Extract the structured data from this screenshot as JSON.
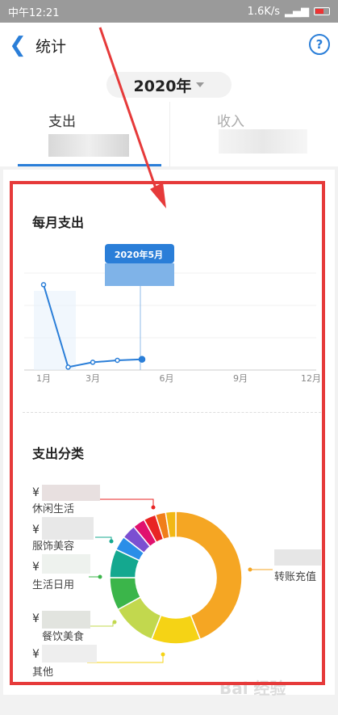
{
  "status": {
    "time": "中午12:21",
    "speed": "1.6K/s"
  },
  "header": {
    "title": "统计",
    "help_label": "?"
  },
  "year_selector": {
    "value": "2020年"
  },
  "tabs": [
    {
      "label": "支出"
    },
    {
      "label": "收入"
    }
  ],
  "monthly": {
    "section_title": "每月支出",
    "tooltip_title": "2020年5月",
    "x_ticks": [
      "1月",
      "3月",
      "6月",
      "9月",
      "12月"
    ]
  },
  "chart_data": [
    {
      "type": "line",
      "title": "每月支出",
      "x": [
        1,
        2,
        3,
        4,
        5
      ],
      "x_tick_labels": [
        "1月",
        "3月",
        "6月",
        "9月",
        "12月"
      ],
      "series": [
        {
          "values": [
            88,
            3,
            8,
            10,
            11
          ]
        }
      ],
      "ylim": [
        0,
        100
      ],
      "highlight": "2020年5月",
      "grid": true
    },
    {
      "type": "pie",
      "title": "支出分类",
      "donut": true,
      "slices": [
        {
          "label": "转账充值",
          "value": 44,
          "color": "#f5a623"
        },
        {
          "label": "其他",
          "value": 12,
          "color": "#f5d315"
        },
        {
          "label": "餐饮美食",
          "value": 11,
          "color": "#c2d84e"
        },
        {
          "label": "生活日用",
          "value": 8,
          "color": "#3bb54a"
        },
        {
          "label": "服饰美容",
          "value": 7,
          "color": "#14a88f"
        },
        {
          "label": "",
          "value": 3.5,
          "color": "#2a8ee8"
        },
        {
          "label": "",
          "value": 3.5,
          "color": "#7b4fd1"
        },
        {
          "label": "",
          "value": 3,
          "color": "#e0116e"
        },
        {
          "label": "休闲生活",
          "value": 3,
          "color": "#e82424"
        },
        {
          "label": "",
          "value": 2.5,
          "color": "#f07e1a"
        },
        {
          "label": "",
          "value": 2.5,
          "color": "#f2b815"
        }
      ]
    }
  ],
  "category": {
    "section_title": "支出分类",
    "currency": "¥",
    "labels": [
      "休闲生活",
      "服饰美容",
      "生活日用",
      "餐饮美食",
      "其他",
      "转账充值"
    ]
  },
  "watermark": "Bai 经验"
}
